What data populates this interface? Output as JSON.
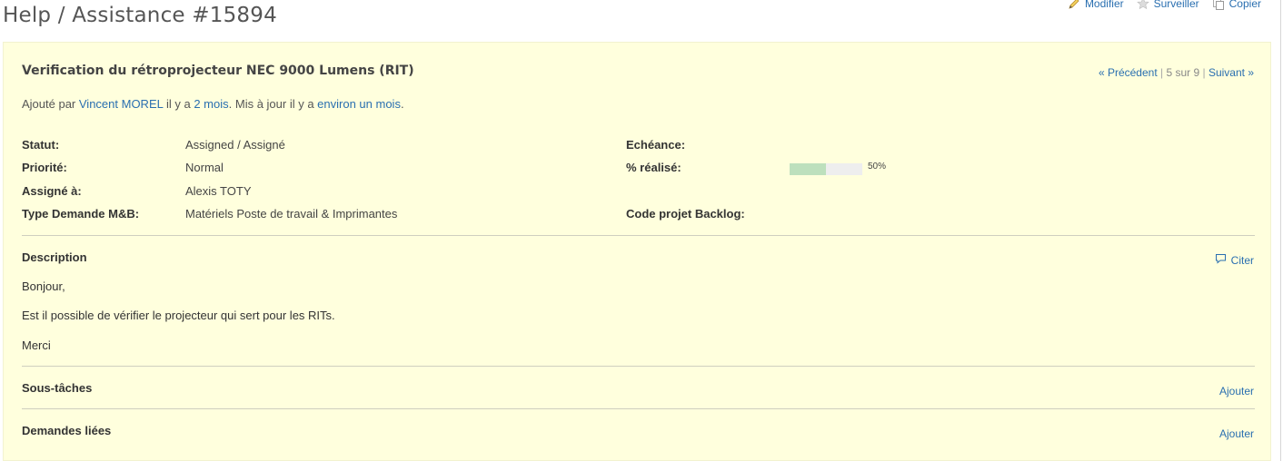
{
  "header": {
    "title": "Help / Assistance #15894",
    "actions": [
      {
        "label": "Modifier",
        "icon": "pencil-icon"
      },
      {
        "label": "Surveiller",
        "icon": "star-icon"
      },
      {
        "label": "Copier",
        "icon": "copy-icon"
      }
    ]
  },
  "issue": {
    "subject": "Verification du rétroprojecteur NEC 9000 Lumens (RIT)",
    "nav": {
      "previous": "« Précédent",
      "position": "5 sur 9",
      "next": "Suivant »"
    },
    "author_line": {
      "prefix": "Ajouté par ",
      "author": "Vincent MOREL",
      "mid1": " il y a ",
      "created": "2 mois",
      "mid2": ". Mis à jour il y a ",
      "updated": "environ un mois",
      "suffix": "."
    },
    "attributes": {
      "status_label": "Statut:",
      "status_value": "Assigned / Assigné",
      "priority_label": "Priorité:",
      "priority_value": "Normal",
      "assignee_label": "Assigné à:",
      "assignee_value": "Alexis TOTY",
      "type_label": "Type Demande M&B:",
      "type_value": "Matériels Poste de travail & Imprimantes",
      "due_label": "Echéance:",
      "done_label": "% réalisé:",
      "done_percent": 50,
      "done_text": "50%",
      "backlog_label": "Code projet Backlog:"
    },
    "description": {
      "title": "Description",
      "quote_label": "Citer",
      "paragraphs": [
        "Bonjour,",
        "Est il possible de vérifier le projecteur qui sert pour les RITs.",
        "Merci"
      ]
    },
    "subtasks": {
      "title": "Sous-tâches",
      "add_label": "Ajouter"
    },
    "relations": {
      "title": "Demandes liées",
      "add_label": "Ajouter"
    }
  },
  "colors": {
    "link": "#2a6fb0",
    "box_background": "#ffffdd",
    "progress_fill": "#bde0bd",
    "progress_track": "#eeeeee"
  }
}
